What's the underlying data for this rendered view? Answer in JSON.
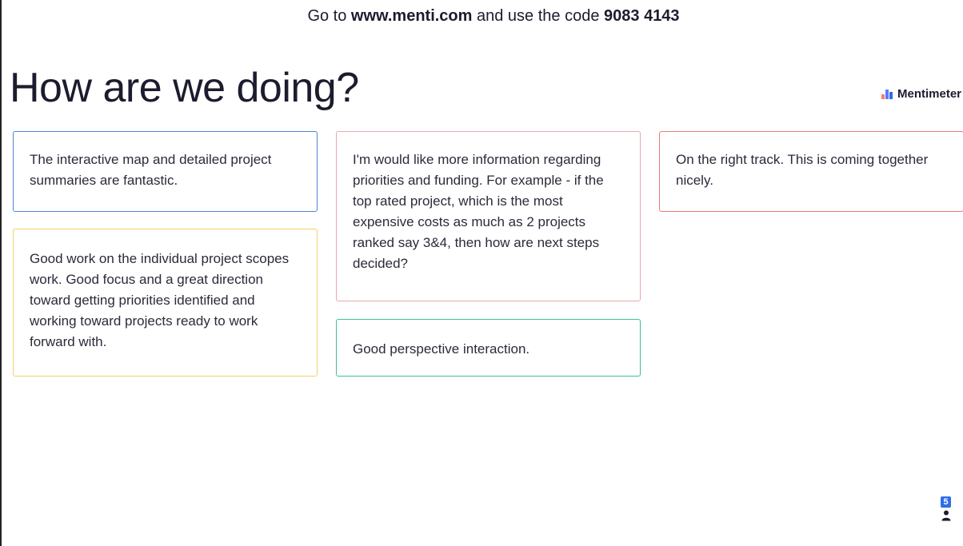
{
  "banner": {
    "prefix": "Go to ",
    "url": "www.menti.com",
    "middle": " and use the code ",
    "code": "9083 4143"
  },
  "title": "How are we doing?",
  "brand": {
    "name": "Mentimeter",
    "icon_colors": [
      "#ff7a6b",
      "#5b7cff",
      "#2f6ee6"
    ]
  },
  "responses": [
    {
      "text": "The interactive map and detailed project summaries are fantastic.",
      "color": "#4a86d9"
    },
    {
      "text": "I'm would like more information regarding priorities and funding. For example - if the top rated project, which is the most expensive costs as much as 2 projects ranked say 3&4, then how are next steps decided?",
      "color": "#f2a3ad"
    },
    {
      "text": "On the right track. This is coming together nicely.",
      "color": "#ef7a6c"
    },
    {
      "text": "Good work on the individual project scopes work. Good focus and a great direction toward getting priorities identified and working toward projects ready to work forward with.",
      "color": "#f3d16a"
    },
    {
      "text": "Good perspective interaction.",
      "color": "#3fbf9a"
    }
  ],
  "participants": {
    "count": "5",
    "icon": "person-icon"
  }
}
